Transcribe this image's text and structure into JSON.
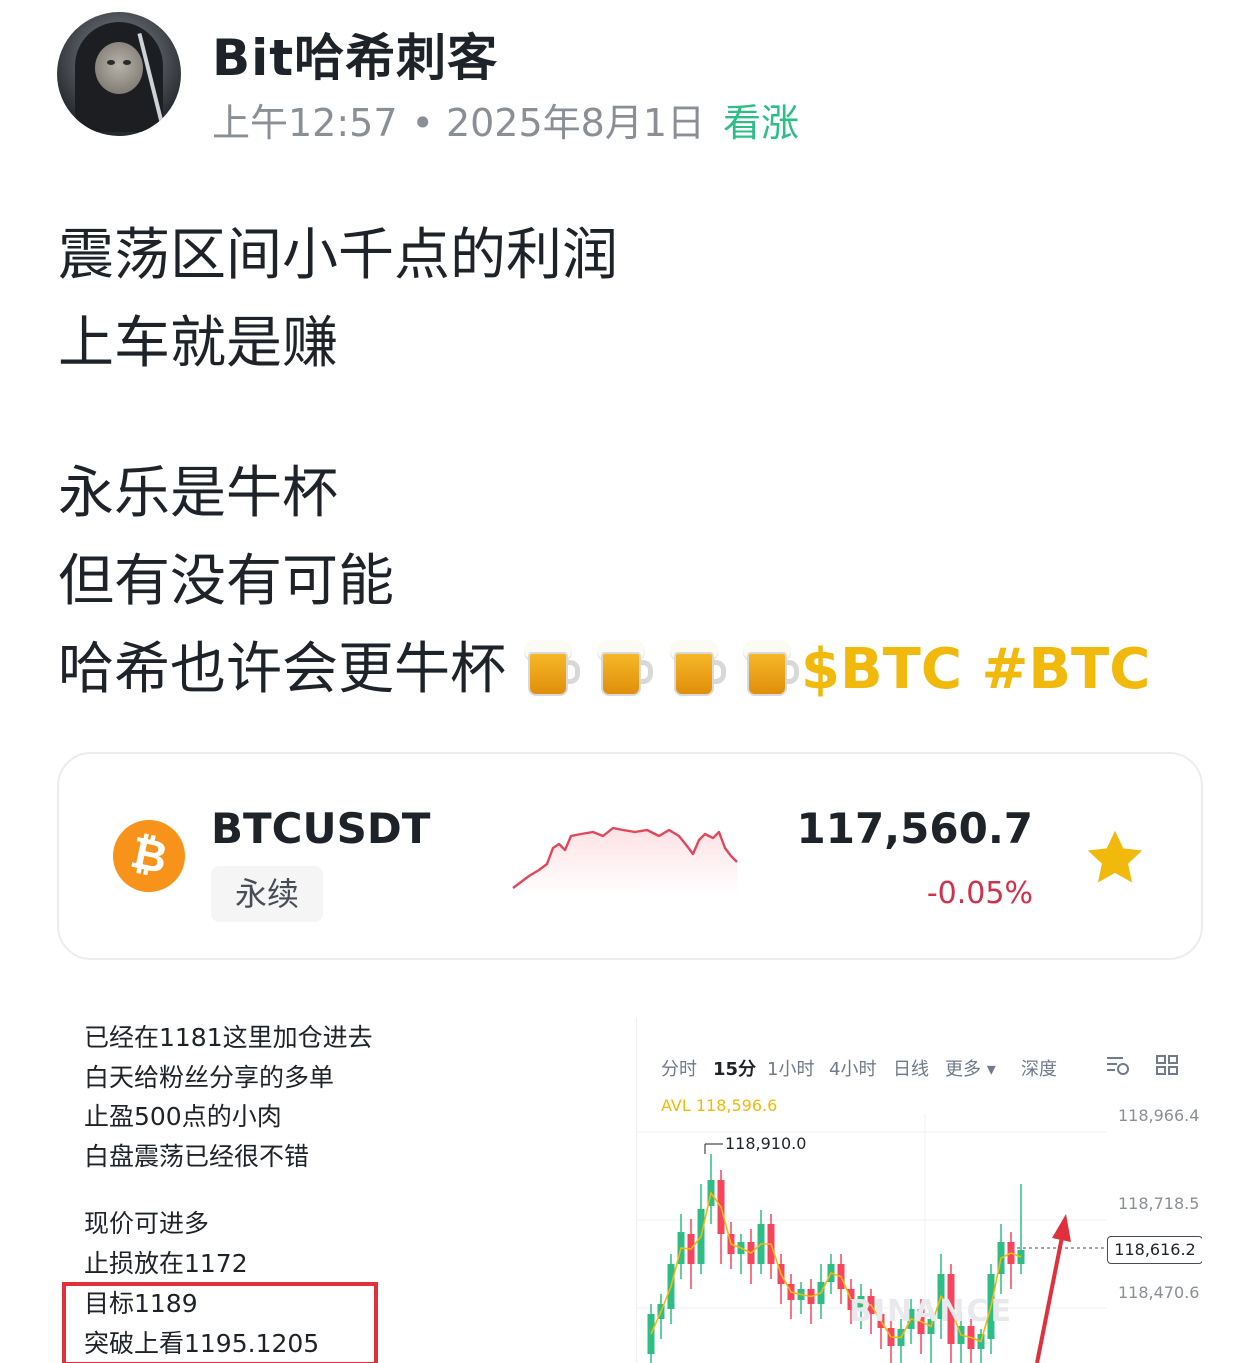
{
  "post": {
    "author": "Bit哈希刺客",
    "time": "上午12:57",
    "date": "2025年8月1日",
    "sentiment": "看涨",
    "lines": [
      "震荡区间小千点的利润",
      "上车就是赚",
      "永乐是牛杯",
      "但有没有可能",
      "哈希也许会更牛杯"
    ],
    "tags": "$BTC #BTC",
    "accent_color": "#f0b90b",
    "sentiment_color": "#2ebd85"
  },
  "ticker_card": {
    "symbol": "BTCUSDT",
    "contract_type": "永续",
    "price": "117,560.7",
    "change": "-0.05%",
    "coin_icon": "bitcoin-icon",
    "favorite_icon": "star-icon",
    "change_color": "#cf304a"
  },
  "left_image": {
    "lines": [
      "已经在1181这里加仓进去",
      "白天给粉丝分享的多单",
      "止盈500点的小肉",
      "白盘震荡已经很不错",
      "现价可进多",
      "止损放在1172",
      "目标1189",
      "突破上看1195.1205"
    ]
  },
  "right_image": {
    "timeframes": [
      "分时",
      "15分",
      "1小时",
      "4小时",
      "日线",
      "更多 ▾",
      "深度"
    ],
    "active_timeframe": "15分",
    "avl": "AVL 118,596.6",
    "high_label": "118,910.0",
    "y_labels": [
      "118,966.4",
      "118,718.5",
      "118,470.6"
    ],
    "current_price": "118,616.2",
    "watermark": "BINANCE"
  }
}
